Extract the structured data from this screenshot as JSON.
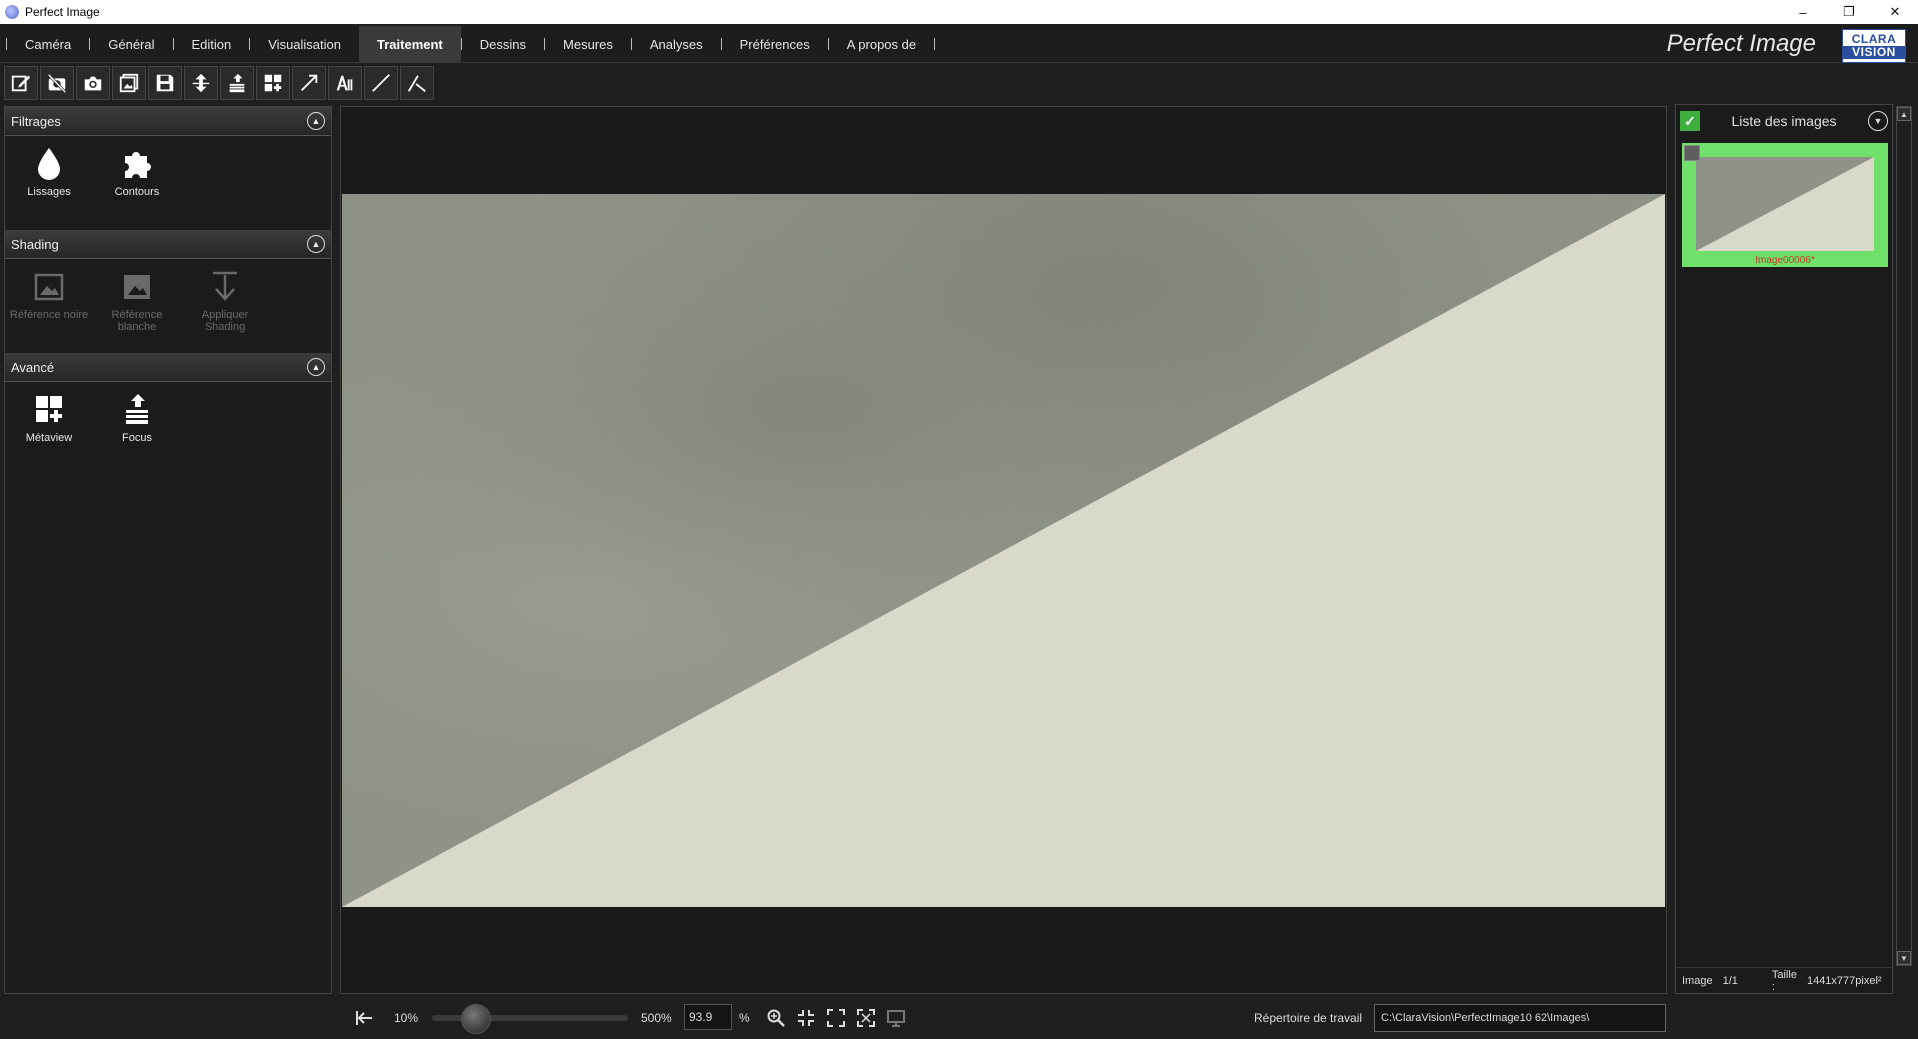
{
  "window": {
    "title": "Perfect Image",
    "controls": {
      "minimize": "–",
      "restore": "❐",
      "close": "✕"
    }
  },
  "menu": {
    "items": [
      {
        "label": "Caméra"
      },
      {
        "label": "Général"
      },
      {
        "label": "Edition"
      },
      {
        "label": "Visualisation"
      },
      {
        "label": "Traitement",
        "active": true
      },
      {
        "label": "Dessins"
      },
      {
        "label": "Mesures"
      },
      {
        "label": "Analyses"
      },
      {
        "label": "Préférences"
      },
      {
        "label": "A propos de"
      }
    ],
    "brand": "Perfect Image",
    "logo_top": "CLARA",
    "logo_bottom": "VISION"
  },
  "toolbar": {
    "icons": [
      "edit-icon",
      "no-camera-icon",
      "camera-icon",
      "image-stack-icon",
      "save-icon",
      "layers-merge-icon",
      "focus-stack-icon",
      "metaview-icon",
      "arrow-icon",
      "text-icon",
      "line-icon",
      "angle-icon"
    ]
  },
  "leftpanel": {
    "sections": [
      {
        "title": "Filtrages",
        "items": [
          {
            "label": "Lissages",
            "icon": "drop-icon"
          },
          {
            "label": "Contours",
            "icon": "puzzle-icon"
          }
        ]
      },
      {
        "title": "Shading",
        "items": [
          {
            "label": "Référence noire",
            "icon": "image-dark-icon"
          },
          {
            "label": "Référence blanche",
            "icon": "image-light-icon"
          },
          {
            "label": "Appliquer Shading",
            "icon": "apply-arrow-icon"
          }
        ]
      },
      {
        "title": "Avancé",
        "items": [
          {
            "label": "Métaview",
            "icon": "metaview-icon"
          },
          {
            "label": "Focus",
            "icon": "focus-stack-icon"
          }
        ]
      }
    ]
  },
  "imagelist": {
    "title": "Liste des images",
    "thumb_name": "Image00006*",
    "footer": {
      "image_label": "Image",
      "image_count": "1/1",
      "size_label": "Taille :",
      "size_value": "1441x777pixel²"
    }
  },
  "statusbar": {
    "zoom_min": "10%",
    "zoom_max": "500%",
    "zoom_value": "93.9",
    "zoom_unit": "%",
    "zoom_slider_fraction": 0.17,
    "workdir_label": "Répertoire de travail",
    "workdir_value": "C:\\ClaraVision\\PerfectImage10 62\\Images\\"
  },
  "colors": {
    "accent_green": "#6fe06a",
    "image_gray": "#8f9286",
    "image_light": "#d8d9cb",
    "thumb_label": "#c0392b"
  }
}
